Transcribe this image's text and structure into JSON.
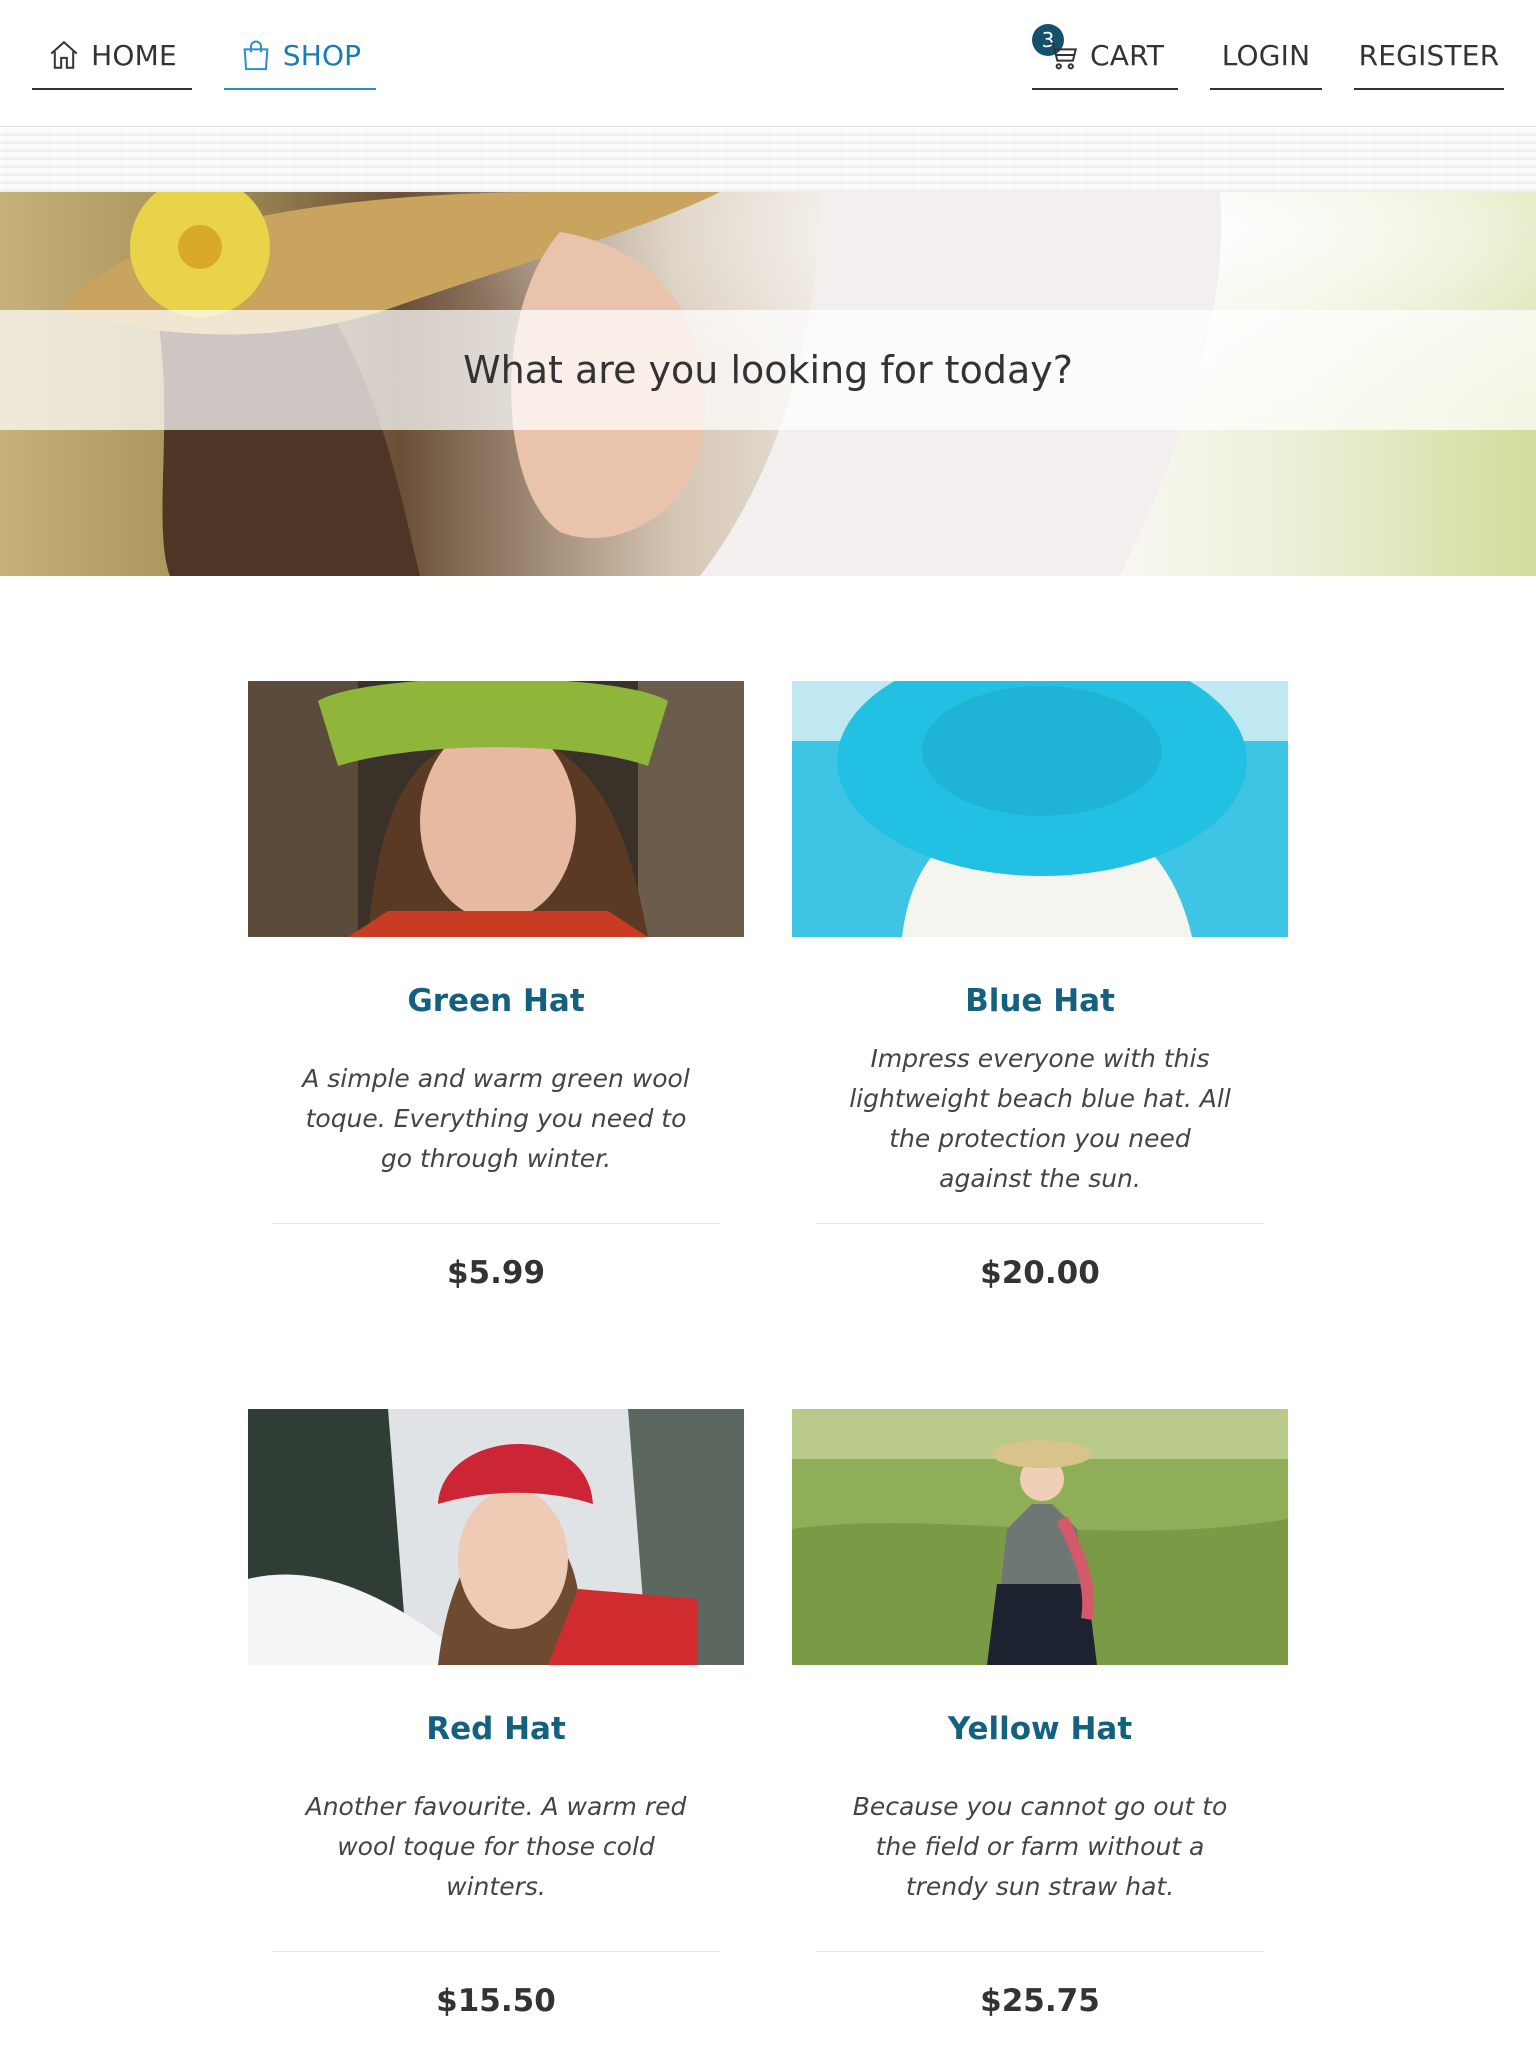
{
  "nav": {
    "home_label": "HOME",
    "shop_label": "SHOP",
    "cart_label": "CART",
    "cart_count": "3",
    "login_label": "LOGIN",
    "register_label": "REGISTER",
    "home_icon": "home-icon",
    "shop_icon": "shopping-bag-icon",
    "cart_icon": "cart-icon",
    "active_color": "#167db5"
  },
  "hero": {
    "title": "What are you looking for today?"
  },
  "products": [
    {
      "name": "Green Hat",
      "description": "A simple and warm green wool toque. Everything you need to go through winter.",
      "price": "$5.99"
    },
    {
      "name": "Blue Hat",
      "description": "Impress everyone with this lightweight beach blue hat. All the protection you need against the sun.",
      "price": "$20.00"
    },
    {
      "name": "Red Hat",
      "description": "Another favourite. A warm red wool toque for those cold winters.",
      "price": "$15.50"
    },
    {
      "name": "Yellow Hat",
      "description": "Because you cannot go out to the field or farm without a trendy sun straw hat.",
      "price": "$25.75"
    }
  ],
  "colors": {
    "title_teal": "#13607f",
    "badge": "#15506d",
    "text": "#333333"
  }
}
